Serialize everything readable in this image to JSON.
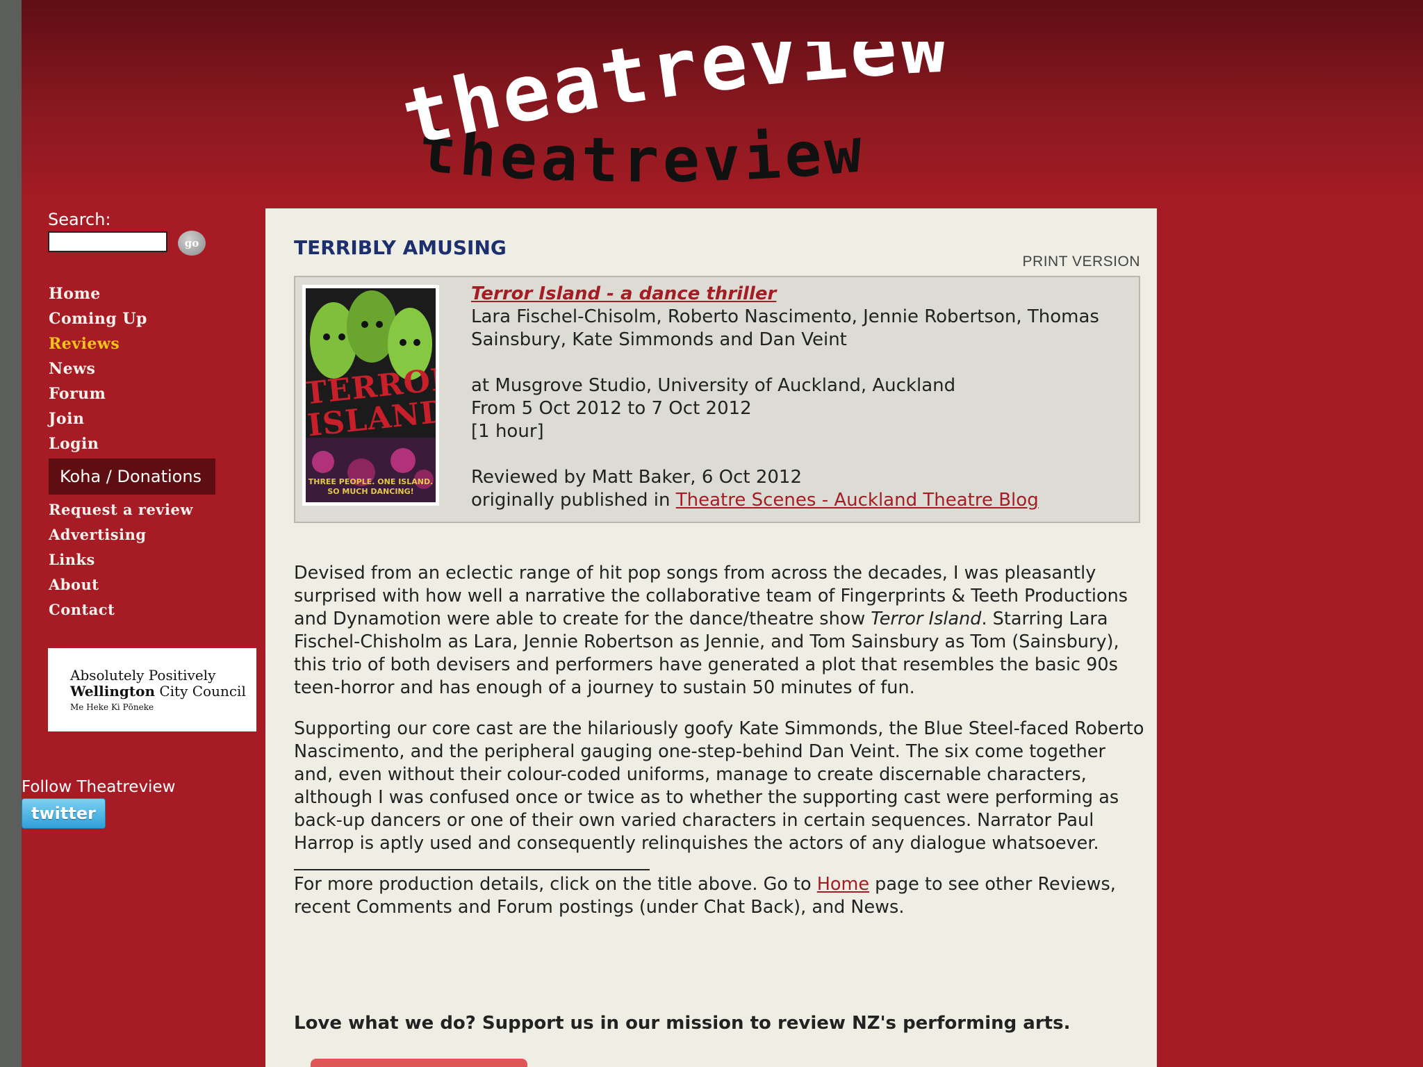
{
  "header": {
    "logo_text": "theatreview",
    "logo_shadow_text": "theatreview"
  },
  "search": {
    "label": "Search:",
    "placeholder": "",
    "go_label": "go"
  },
  "nav": {
    "items": [
      {
        "label": "Home",
        "active": false
      },
      {
        "label": "Coming Up",
        "active": false
      },
      {
        "label": "Reviews",
        "active": true
      },
      {
        "label": "News",
        "active": false
      },
      {
        "label": "Forum",
        "active": false
      },
      {
        "label": "Join",
        "active": false
      },
      {
        "label": "Login",
        "active": false
      }
    ],
    "koha_label": "Koha / Donations",
    "secondary_items": [
      "Request a review",
      "Advertising",
      "Links",
      "About",
      "Contact"
    ]
  },
  "sponsor": {
    "line1": "Absolutely Positively",
    "line2_bold": "Wellington",
    "line2_rest": " City Council",
    "line3": "Me Heke Ki Pōneke"
  },
  "social": {
    "follow_text": "Follow Theatreview",
    "twitter_label": "twitter"
  },
  "review": {
    "heading": "TERRIBLY AMUSING",
    "print_version": "PRINT VERSION",
    "poster": {
      "title": "TERROR ISLAND",
      "tagline": "THREE PEOPLE. ONE ISLAND. SO MUCH DANCING!"
    },
    "show_title": "Terror Island - a dance thriller",
    "cast": "Lara Fischel-Chisolm, Roberto Nascimento, Jennie Robertson, Thomas Sainsbury, Kate Simmonds and Dan Veint",
    "venue": "at Musgrove Studio, University of Auckland, Auckland",
    "dates": "From 5 Oct 2012 to 7 Oct 2012",
    "duration": "[1 hour]",
    "reviewed_by": "Reviewed by Matt Baker, 6 Oct 2012",
    "published_prefix": "originally published in ",
    "published_link": "Theatre Scenes - Auckland Theatre Blog",
    "para1_a": "Devised from an eclectic range of hit pop songs from across the decades, I was pleasantly surprised with how well a narrative the collaborative team of Fingerprints & Teeth Productions and Dynamotion were able to create for the dance/theatre show ",
    "para1_em": "Terror Island",
    "para1_b": ". Starring Lara Fischel-Chisholm as Lara, Jennie Robertson as Jennie, and Tom Sainsbury as Tom (Sainsbury), this trio of both devisers and performers have generated a plot that resembles the basic 90s teen-horror and has enough of a journey to sustain 50 minutes of fun.",
    "para2": "Supporting our core cast are the hilariously goofy Kate Simmonds, the Blue Steel-faced Roberto Nascimento, and the peripheral gauging one-step-behind Dan Veint. The six come together and, even without their colour-coded uniforms, manage to create discernable characters, although I was confused once or twice as to whether the supporting cast were performing as back-up dancers or one of their own varied characters in certain sequences. Narrator Paul Harrop is aptly used and consequently relinquishes the actors of any dialogue whatsoever.",
    "footer_a": "For more production details, click on the title above. Go to ",
    "footer_link": "Home",
    "footer_b": " page to see other Reviews, recent Comments and Forum postings (under Chat Back), and News.",
    "support": "Love what we do? Support us in our mission to review NZ's performing arts."
  },
  "colors": {
    "brand_red": "#a71c24",
    "active_nav": "#f2c31c",
    "heading_blue": "#1e2f6e",
    "link_red": "#a41d24"
  }
}
